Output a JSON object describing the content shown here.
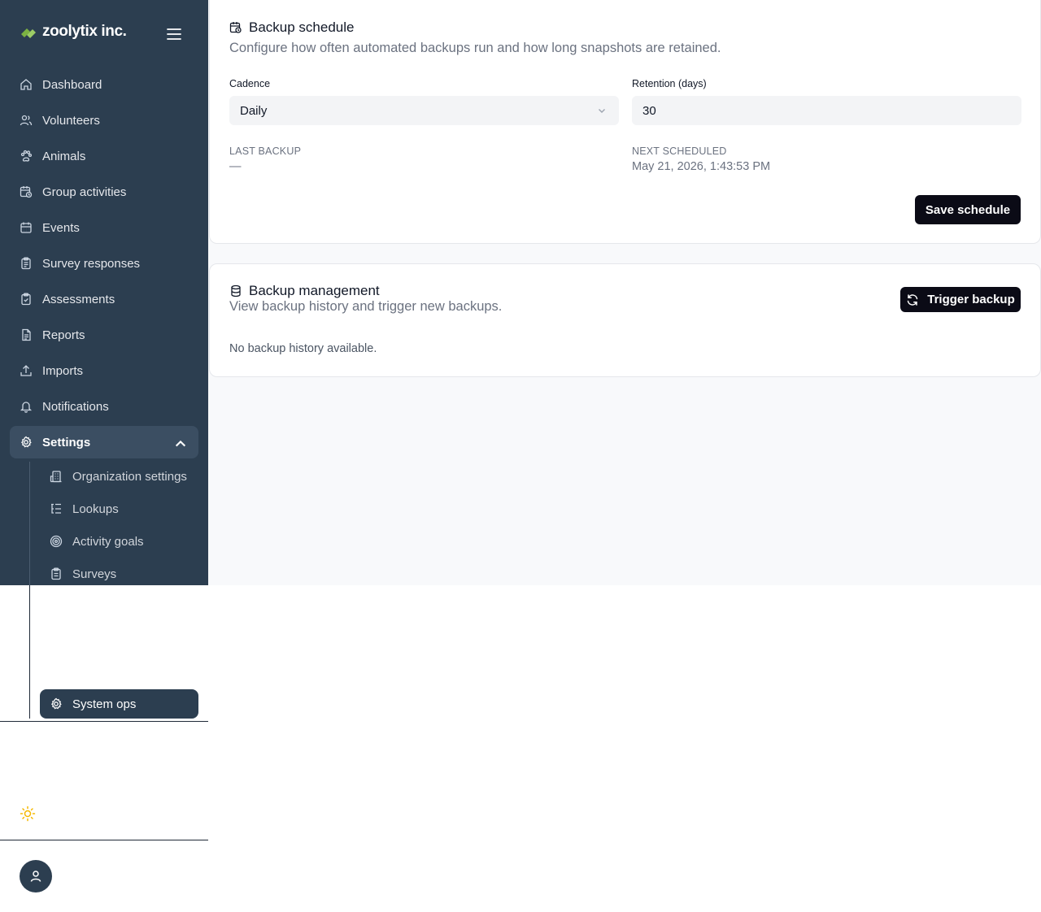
{
  "brand": {
    "name": "zoolytix inc.",
    "logo_icon": "leaf-logo",
    "accent": "#8bc34a"
  },
  "sidebar": {
    "items": [
      {
        "label": "Dashboard",
        "icon": "home-icon"
      },
      {
        "label": "Volunteers",
        "icon": "users-icon"
      },
      {
        "label": "Animals",
        "icon": "paw-icon"
      },
      {
        "label": "Group activities",
        "icon": "calendar-clock-icon"
      },
      {
        "label": "Events",
        "icon": "calendar-icon"
      },
      {
        "label": "Survey responses",
        "icon": "clipboard-list-icon"
      },
      {
        "label": "Assessments",
        "icon": "clipboard-check-icon"
      },
      {
        "label": "Reports",
        "icon": "file-text-icon"
      },
      {
        "label": "Imports",
        "icon": "upload-icon"
      },
      {
        "label": "Notifications",
        "icon": "bell-icon"
      },
      {
        "label": "Settings",
        "icon": "gear-icon",
        "expanded": true
      }
    ],
    "settings_children": [
      {
        "label": "Organization settings",
        "icon": "building-icon"
      },
      {
        "label": "Lookups",
        "icon": "list-tree-icon"
      },
      {
        "label": "Activity goals",
        "icon": "target-icon"
      },
      {
        "label": "Surveys",
        "icon": "clipboard-icon"
      },
      {
        "label": "System ops",
        "icon": "gear-icon",
        "active": true
      }
    ],
    "theme_toggle_icon": "sun-icon",
    "avatar_icon": "user-icon"
  },
  "backup_schedule": {
    "title": "Backup schedule",
    "description": "Configure how often automated backups run and how long snapshots are retained.",
    "cadence_label": "Cadence",
    "cadence_value": "Daily",
    "retention_label": "Retention (days)",
    "retention_value": "30",
    "last_backup_label": "LAST BACKUP",
    "last_backup_value": "—",
    "next_scheduled_label": "NEXT SCHEDULED",
    "next_scheduled_value": "May 21, 2026, 1:43:53 PM",
    "save_label": "Save schedule"
  },
  "backup_management": {
    "title": "Backup management",
    "description": "View backup history and trigger new backups.",
    "trigger_label": "Trigger backup",
    "empty_text": "No backup history available."
  }
}
